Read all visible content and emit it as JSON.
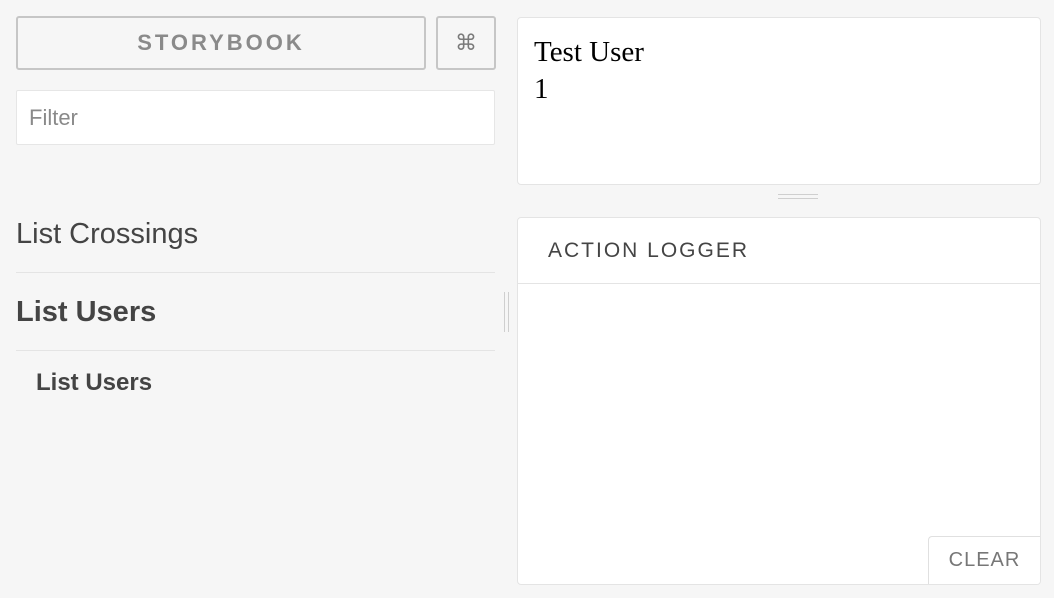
{
  "header": {
    "title": "STORYBOOK",
    "shortcut_icon": "command-icon",
    "shortcut_glyph": "⌘"
  },
  "filter": {
    "placeholder": "Filter",
    "value": ""
  },
  "sidebar": {
    "kinds": [
      {
        "label": "List Crossings",
        "selected": false
      },
      {
        "label": "List Users",
        "selected": true,
        "stories": [
          {
            "label": "List Users",
            "selected": true
          }
        ]
      }
    ]
  },
  "preview": {
    "lines": [
      "Test User",
      "1"
    ]
  },
  "addon_panel": {
    "tab_label": "ACTION LOGGER",
    "clear_label": "CLEAR"
  }
}
